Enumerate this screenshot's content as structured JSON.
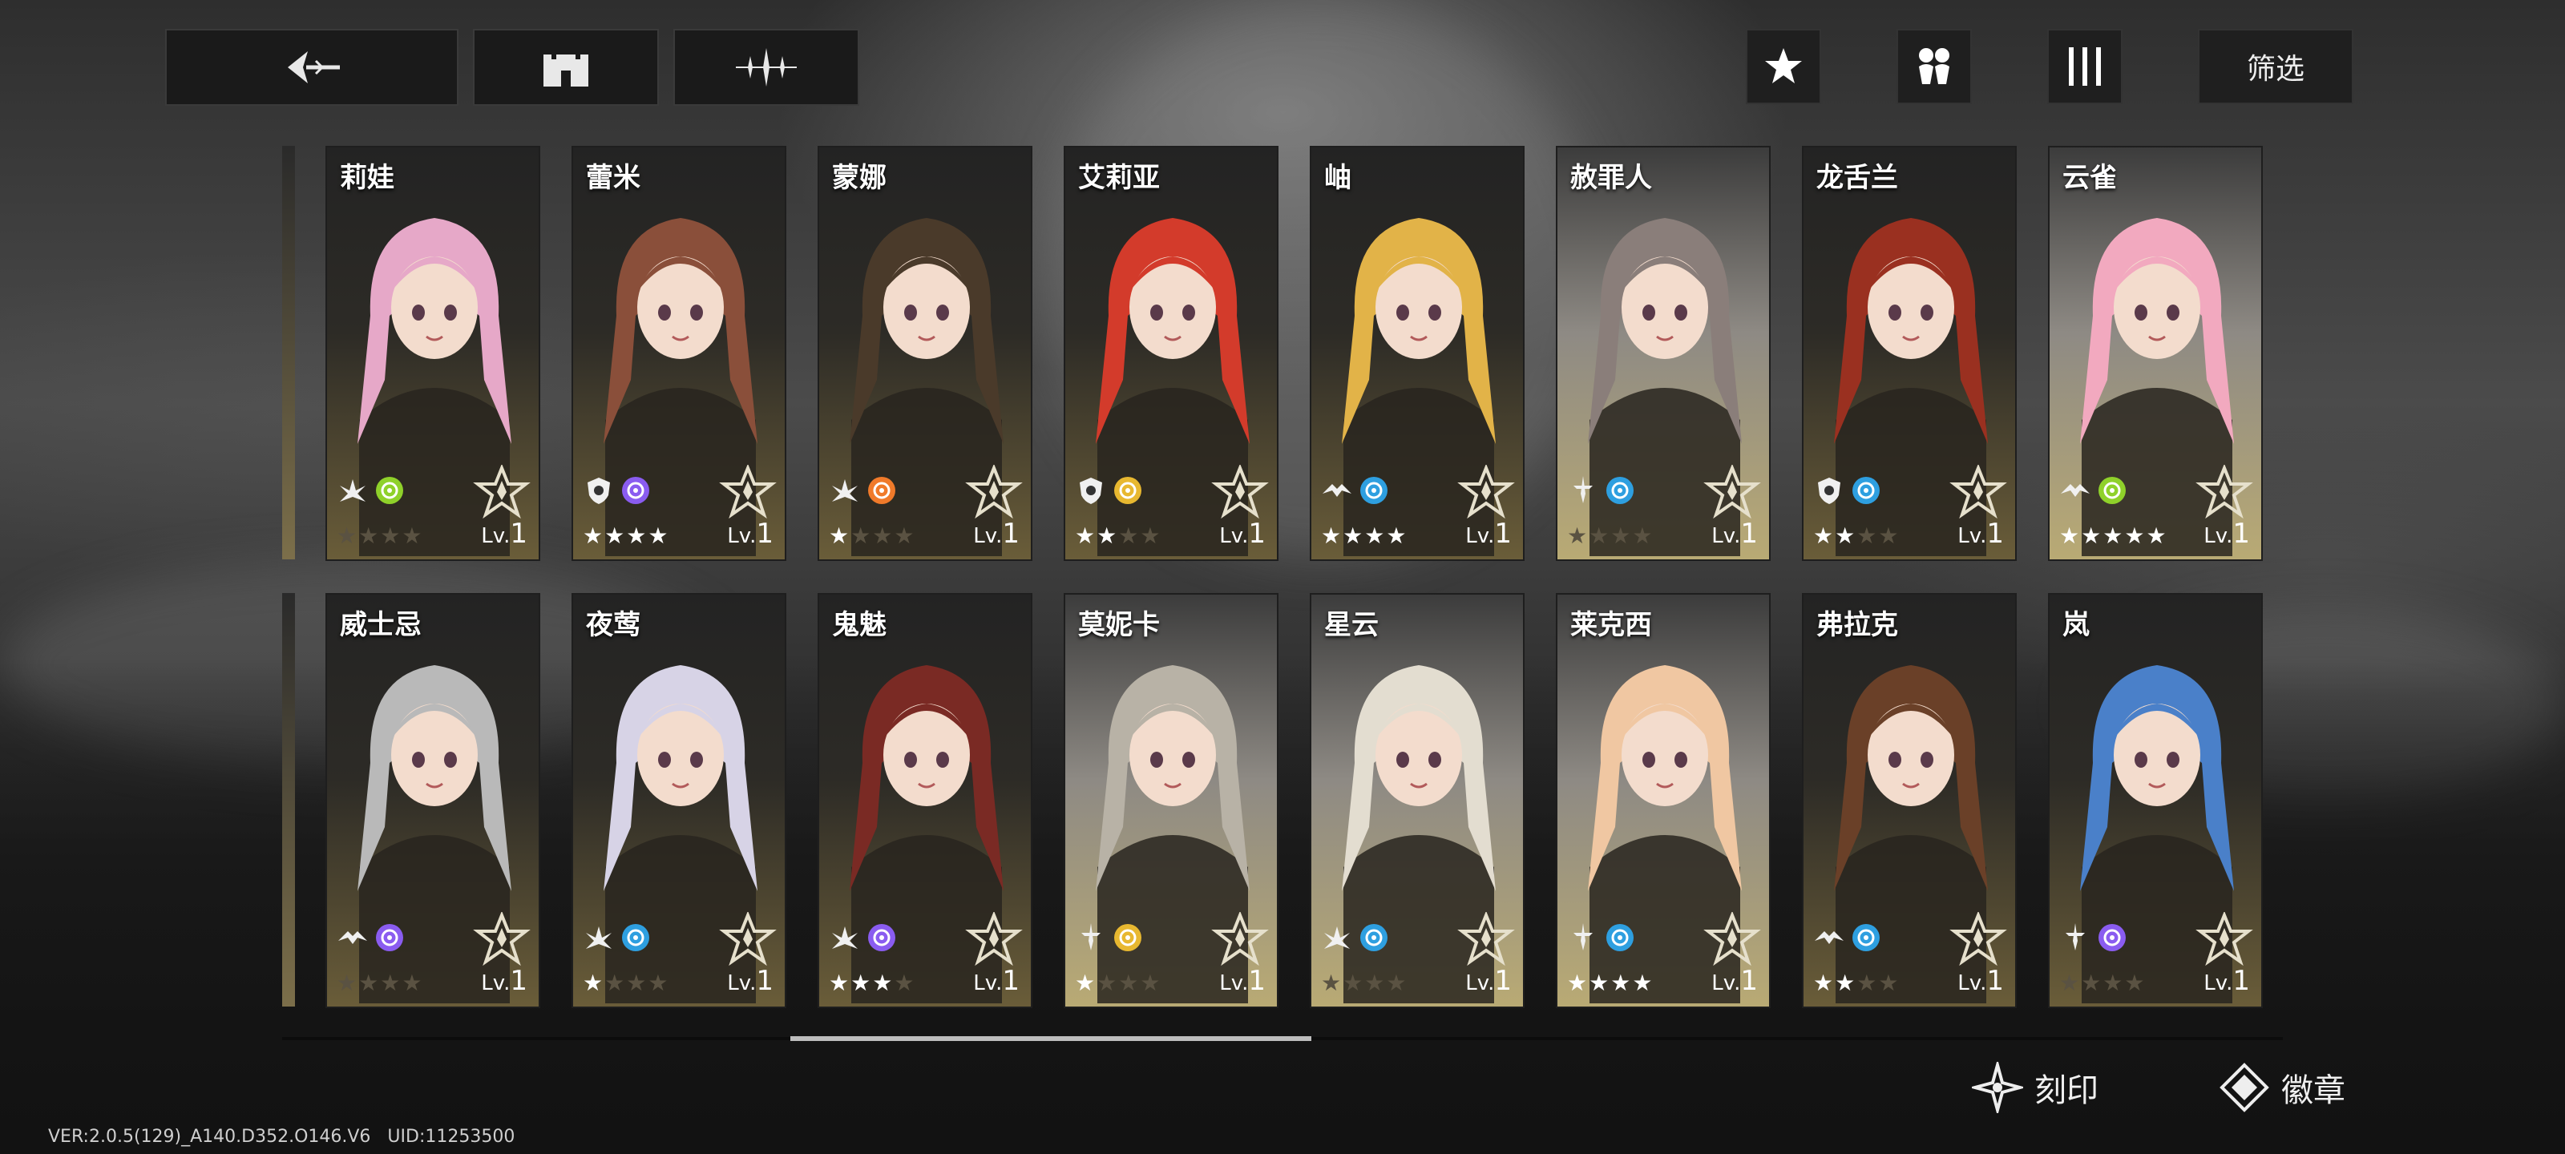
{
  "topbar": {
    "back_icon": "back-arrow-icon",
    "castle_icon": "castle-icon",
    "sparkle_icon": "sparkle-icon",
    "star_icon": "star-icon",
    "team_icon": "team-icon",
    "column_icon": "columns-icon",
    "filter_label": "筛选"
  },
  "characters": [
    {
      "name": "莉娃",
      "stars_text": "★★★★",
      "stars_filled": 0,
      "lv_prefix": "Lv.",
      "level": "1",
      "light": false,
      "hair": "#e6a8c8",
      "icons": [
        "wing-icon",
        "leaf-element-icon"
      ],
      "elem": "#8fd12a"
    },
    {
      "name": "蕾米",
      "stars_text": "★★★★",
      "stars_filled": 4,
      "lv_prefix": "Lv.",
      "level": "1",
      "light": false,
      "hair": "#8a4f3a",
      "icons": [
        "shield-icon",
        "void-element-icon"
      ],
      "elem": "#8a5cf0"
    },
    {
      "name": "蒙娜",
      "stars_text": "★★★★",
      "stars_filled": 1,
      "lv_prefix": "Lv.",
      "level": "1",
      "light": false,
      "hair": "#4a3a2a",
      "icons": [
        "wing-icon",
        "fire-element-icon"
      ],
      "elem": "#f07a2a"
    },
    {
      "name": "艾莉亚",
      "stars_text": "★★★★",
      "stars_filled": 2,
      "lv_prefix": "Lv.",
      "level": "1",
      "light": false,
      "hair": "#d33b2b",
      "icons": [
        "shield-icon",
        "light-element-icon"
      ],
      "elem": "#e8b830"
    },
    {
      "name": "岫",
      "stars_text": "★★★★",
      "stars_filled": 4,
      "lv_prefix": "Lv.",
      "level": "1",
      "light": false,
      "hair": "#e2b348",
      "icons": [
        "bird-icon",
        "water-element-icon"
      ],
      "elem": "#2e9fe0"
    },
    {
      "name": "赦罪人",
      "stars_text": "★★★★",
      "stars_filled": 0,
      "lv_prefix": "Lv.",
      "level": "1",
      "light": true,
      "hair": "#8a7e7a",
      "icons": [
        "sword-icon",
        "water-element-icon"
      ],
      "elem": "#2e9fe0"
    },
    {
      "name": "龙舌兰",
      "stars_text": "★★★★",
      "stars_filled": 2,
      "lv_prefix": "Lv.",
      "level": "1",
      "light": false,
      "hair": "#9a3020",
      "icons": [
        "shield-icon",
        "water-element-icon"
      ],
      "elem": "#2e9fe0"
    },
    {
      "name": "云雀",
      "stars_text": "★★★★★",
      "stars_filled": 5,
      "lv_prefix": "Lv.",
      "level": "1",
      "light": true,
      "hair": "#f2a9bf",
      "icons": [
        "bird-icon",
        "leaf-element-icon"
      ],
      "elem": "#8fd12a"
    },
    {
      "name": "威士忌",
      "stars_text": "★★★★",
      "stars_filled": 0,
      "lv_prefix": "Lv.",
      "level": "1",
      "light": false,
      "hair": "#b9b9b9",
      "icons": [
        "bird-icon",
        "void-element-icon"
      ],
      "elem": "#8a5cf0"
    },
    {
      "name": "夜莺",
      "stars_text": "★★★★",
      "stars_filled": 1,
      "lv_prefix": "Lv.",
      "level": "1",
      "light": false,
      "hair": "#d7d3e6",
      "icons": [
        "wing-icon",
        "water-element-icon"
      ],
      "elem": "#2e9fe0"
    },
    {
      "name": "鬼魅",
      "stars_text": "★★★★",
      "stars_filled": 3,
      "lv_prefix": "Lv.",
      "level": "1",
      "light": false,
      "hair": "#7a2a24",
      "icons": [
        "wing-icon",
        "void-element-icon"
      ],
      "elem": "#8a5cf0"
    },
    {
      "name": "莫妮卡",
      "stars_text": "★★★★",
      "stars_filled": 1,
      "lv_prefix": "Lv.",
      "level": "1",
      "light": true,
      "hair": "#b8b2a6",
      "icons": [
        "sword-icon",
        "light-element-icon"
      ],
      "elem": "#e8b830"
    },
    {
      "name": "星云",
      "stars_text": "★★★★",
      "stars_filled": 0,
      "lv_prefix": "Lv.",
      "level": "1",
      "light": true,
      "hair": "#e3ddd0",
      "icons": [
        "wing-icon",
        "water-element-icon"
      ],
      "elem": "#2e9fe0"
    },
    {
      "name": "莱克西",
      "stars_text": "★★★★",
      "stars_filled": 4,
      "lv_prefix": "Lv.",
      "level": "1",
      "light": true,
      "hair": "#f0c7a2",
      "icons": [
        "sword-icon",
        "water-element-icon"
      ],
      "elem": "#2e9fe0"
    },
    {
      "name": "弗拉克",
      "stars_text": "★★★★",
      "stars_filled": 2,
      "lv_prefix": "Lv.",
      "level": "1",
      "light": false,
      "hair": "#6a4028",
      "icons": [
        "bird-icon",
        "water-element-icon"
      ],
      "elem": "#2e9fe0"
    },
    {
      "name": "岚",
      "stars_text": "★★★★",
      "stars_filled": 0,
      "lv_prefix": "Lv.",
      "level": "1",
      "light": false,
      "hair": "#4a80c9",
      "icons": [
        "sword-icon",
        "void-element-icon"
      ],
      "elem": "#8a5cf0"
    }
  ],
  "bottom": {
    "engrave_label": "刻印",
    "badge_label": "徽章"
  },
  "footer": {
    "version": "VER:2.0.5(129)_A140.D352.O146.V6",
    "uid": "UID:11253500"
  },
  "colors": {
    "star_filled": "#ffffff",
    "star_empty": "#5a5242"
  }
}
